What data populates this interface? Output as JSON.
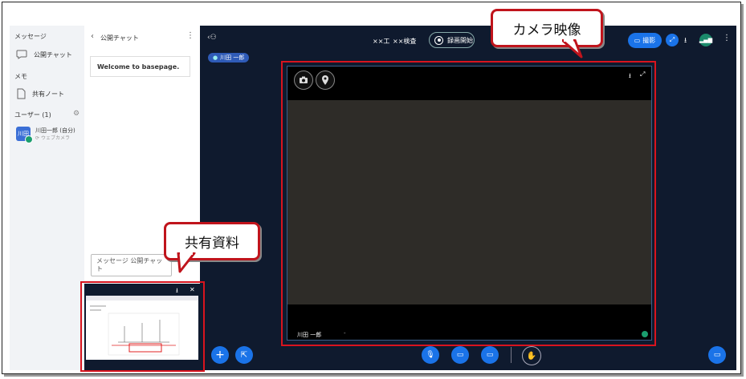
{
  "sidebar": {
    "section_message": "メッセージ",
    "item_public_chat": "公開チャット",
    "section_memo": "メモ",
    "item_shared_note": "共有ノート",
    "section_users": "ユーザー (1)",
    "user_avatar": "川田",
    "user_name": "川田一郎 (自分)",
    "user_device": "ウェブカメラ"
  },
  "chat": {
    "title": "公開チャット",
    "welcome": "Welcome to basepage.",
    "input_placeholder": "メッセージ 公開チャット"
  },
  "topbar": {
    "meeting_part1": "××工",
    "meeting_part2": "××検査",
    "record_label": "録画開始",
    "shoot_label": "撮影"
  },
  "presenter_chip": "川田 一郎",
  "video": {
    "name_label": "川田 一郎",
    "dash": "-"
  },
  "annotations": {
    "camera_label": "カメラ映像",
    "shared_label": "共有資料"
  },
  "colors": {
    "accent": "#1a73e8",
    "highlight": "#d8141e",
    "app_bg": "#0f1a2e"
  }
}
